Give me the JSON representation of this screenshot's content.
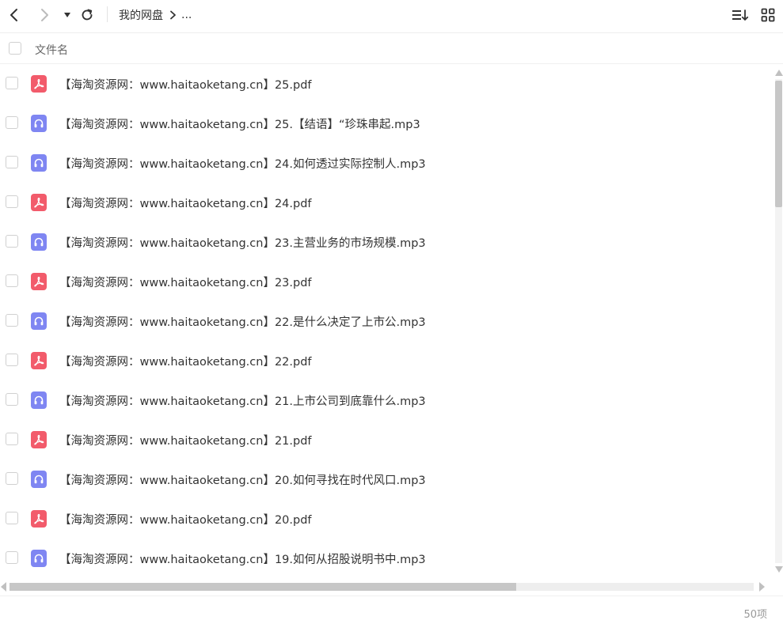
{
  "toolbar": {
    "back_icon": "chevron-left-icon",
    "forward_icon": "chevron-right-icon",
    "dropdown_icon": "caret-down-icon",
    "refresh_icon": "refresh-icon",
    "sort_icon": "sort-icon",
    "grid_view_icon": "grid-view-icon"
  },
  "breadcrumb": {
    "root": "我的网盘",
    "separator_icon": "chevron-right-icon",
    "more": "..."
  },
  "header": {
    "name_column": "文件名"
  },
  "files": [
    {
      "name": "【海淘资源网：www.haitaoketang.cn】25.pdf",
      "type": "pdf"
    },
    {
      "name": "【海淘资源网：www.haitaoketang.cn】25.【结语】“珍珠串起.mp3",
      "type": "mp3"
    },
    {
      "name": "【海淘资源网：www.haitaoketang.cn】24.如何透过实际控制人.mp3",
      "type": "mp3"
    },
    {
      "name": "【海淘资源网：www.haitaoketang.cn】24.pdf",
      "type": "pdf"
    },
    {
      "name": "【海淘资源网：www.haitaoketang.cn】23.主营业务的市场规模.mp3",
      "type": "mp3"
    },
    {
      "name": "【海淘资源网：www.haitaoketang.cn】23.pdf",
      "type": "pdf"
    },
    {
      "name": "【海淘资源网：www.haitaoketang.cn】22.是什么决定了上市公.mp3",
      "type": "mp3"
    },
    {
      "name": "【海淘资源网：www.haitaoketang.cn】22.pdf",
      "type": "pdf"
    },
    {
      "name": "【海淘资源网：www.haitaoketang.cn】21.上市公司到底靠什么.mp3",
      "type": "mp3"
    },
    {
      "name": "【海淘资源网：www.haitaoketang.cn】21.pdf",
      "type": "pdf"
    },
    {
      "name": "【海淘资源网：www.haitaoketang.cn】20.如何寻找在时代风口.mp3",
      "type": "mp3"
    },
    {
      "name": "【海淘资源网：www.haitaoketang.cn】20.pdf",
      "type": "pdf"
    },
    {
      "name": "【海淘资源网：www.haitaoketang.cn】19.如何从招股说明书中.mp3",
      "type": "mp3"
    }
  ],
  "footer": {
    "item_count": "50项"
  },
  "colors": {
    "pdf_icon": "#f25b6b",
    "mp3_icon": "#7f86f2",
    "text": "#333333",
    "muted": "#999999"
  }
}
